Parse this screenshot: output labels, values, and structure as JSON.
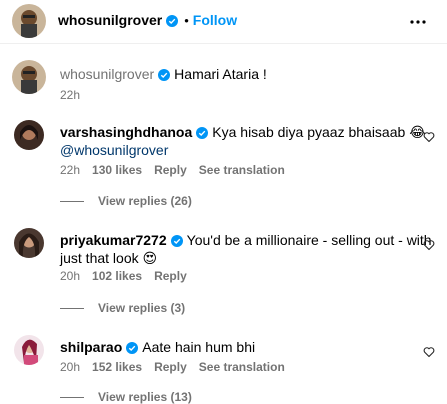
{
  "header": {
    "username": "whosunilgrover",
    "separator": "•",
    "follow_label": "Follow"
  },
  "caption": {
    "username": "whosunilgrover",
    "text": "Hamari Ataria !",
    "time": "22h"
  },
  "comments": [
    {
      "username": "varshasinghdhanoa",
      "text": "Kya hisab diya pyaaz bhaisaab",
      "emoji": "😂",
      "mention": "@whosunilgrover",
      "time": "22h",
      "likes": "130 likes",
      "reply_label": "Reply",
      "translate_label": "See translation",
      "view_replies": "View replies (26)"
    },
    {
      "username": "priyakumar7272",
      "text": "You'd be a millionaire - selling out - with",
      "text_line2": "just that look",
      "emoji": "😍",
      "time": "20h",
      "likes": "102 likes",
      "reply_label": "Reply",
      "view_replies": "View replies (3)"
    },
    {
      "username": "shilparao",
      "text": "Aate hain hum bhi",
      "time": "20h",
      "likes": "152 likes",
      "reply_label": "Reply",
      "translate_label": "See translation",
      "view_replies": "View replies (13)"
    }
  ],
  "colors": {
    "link_blue": "#0095f6",
    "verified_blue": "#0095f6",
    "meta_gray": "#737373"
  }
}
